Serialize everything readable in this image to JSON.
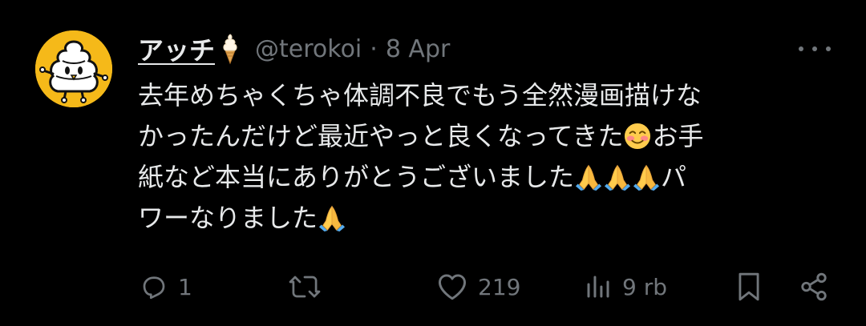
{
  "tweet": {
    "author_name": "アッチ",
    "name_emoji": "soft-ice-cream-icon",
    "handle": "@terokoi",
    "separator": "·",
    "date": "8 Apr",
    "text_line1": "去年めちゃくちゃ体調不良でもう全然漫画描けな",
    "text_line2a": "かったんだけど最近やっと良くなってきた",
    "text_line2b": "お手",
    "text_line3a": "紙など本当にありがとうございました",
    "text_line3b": "パ",
    "text_line4a": "ワーなりました"
  },
  "actions": {
    "reply_count": "1",
    "retweet_count": "",
    "like_count": "219",
    "view_count": "9 rb"
  },
  "colors": {
    "background": "#000000",
    "text": "#e7e9ea",
    "muted": "#71767b",
    "avatar_bg": "#f5b919"
  }
}
